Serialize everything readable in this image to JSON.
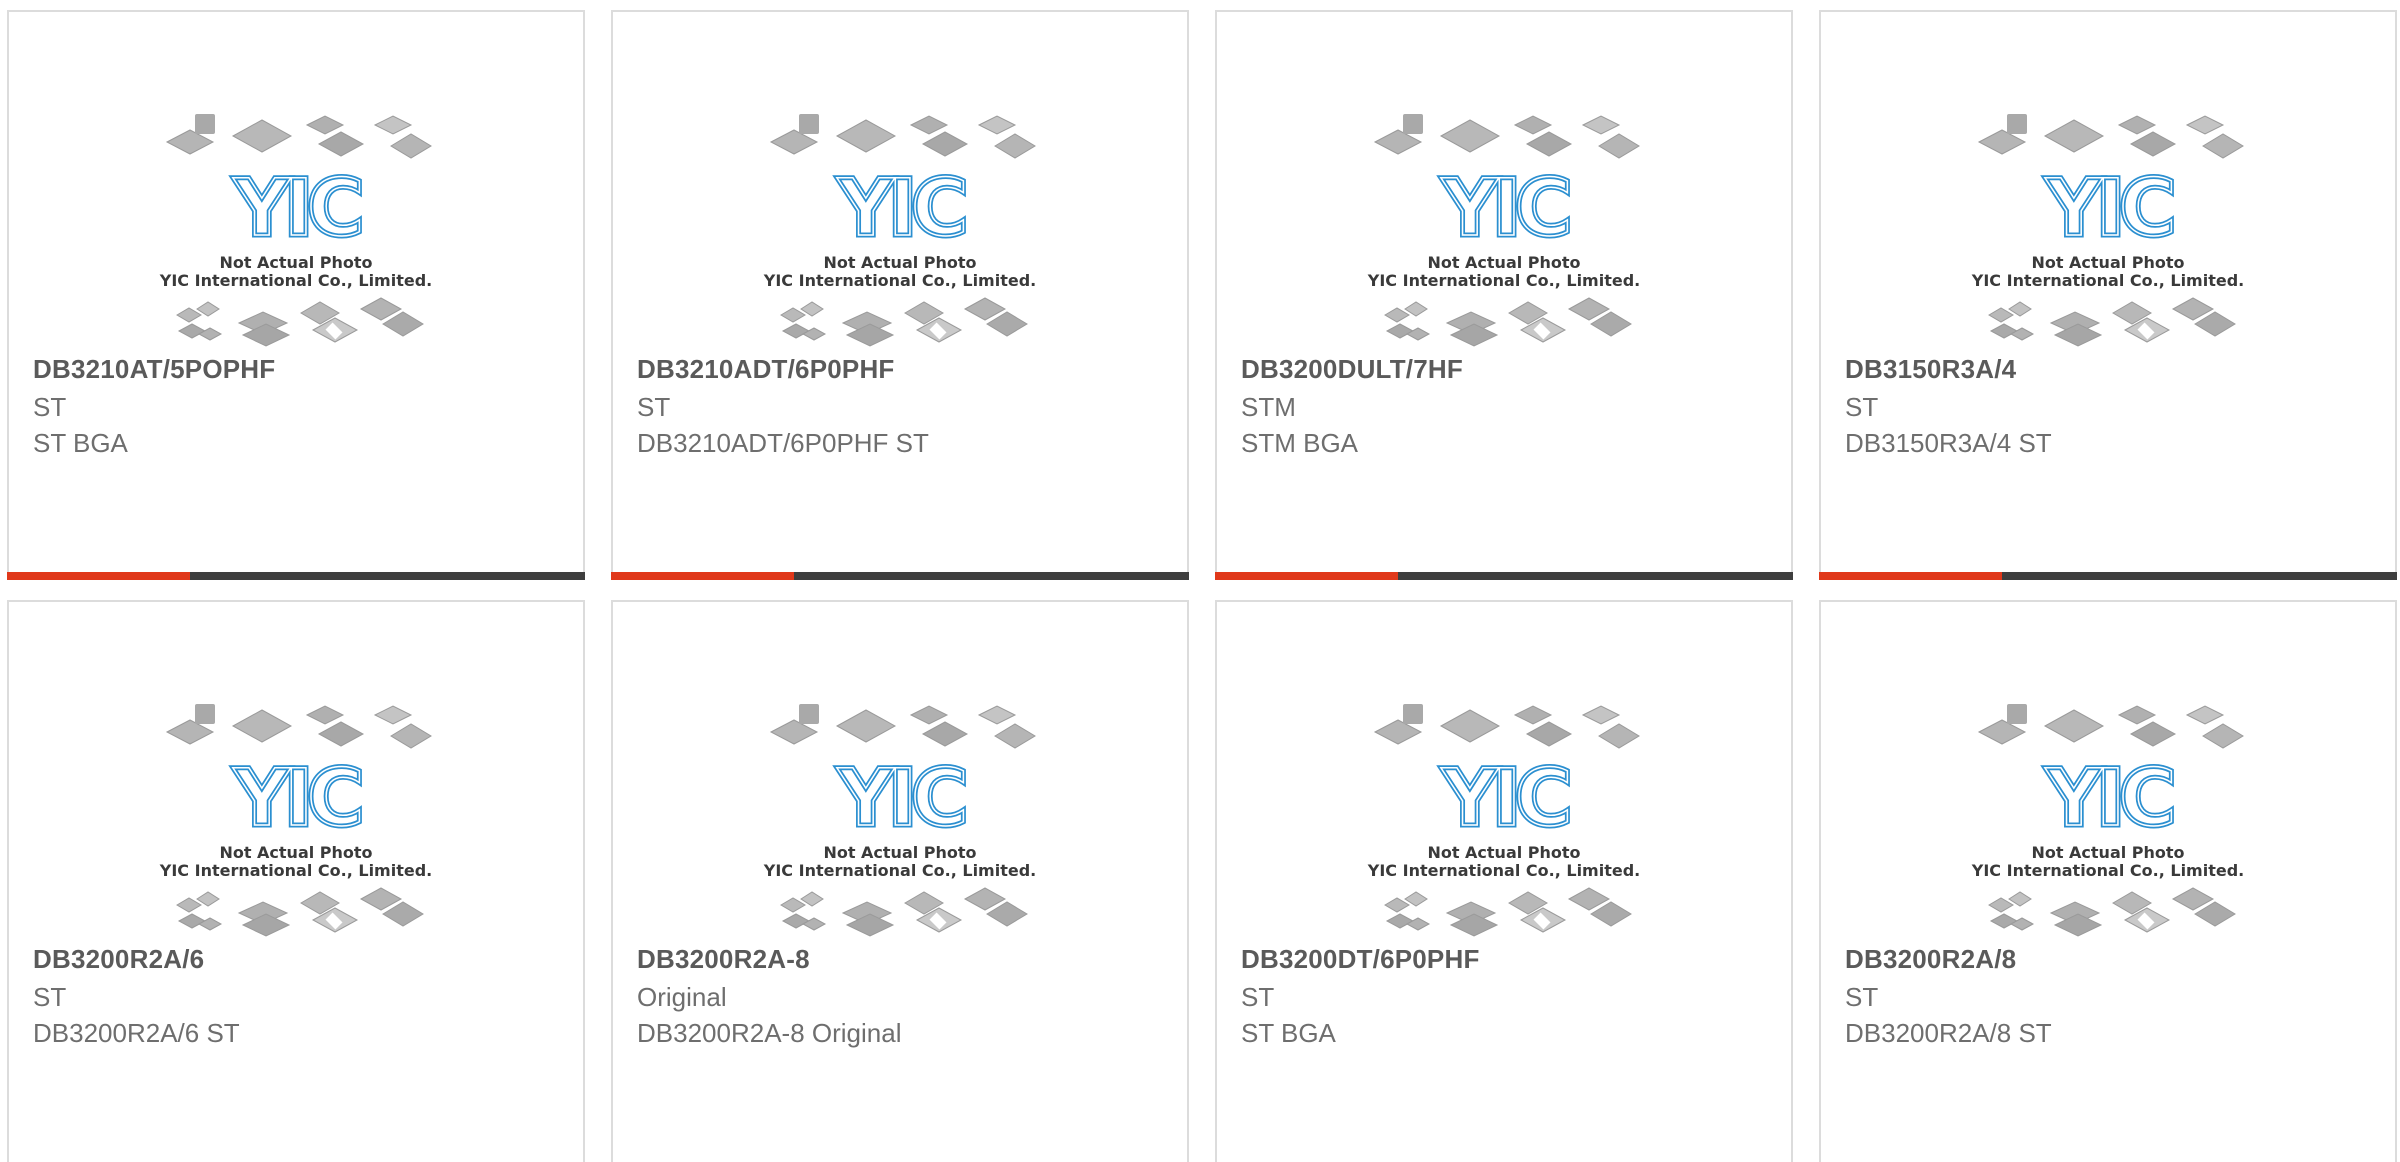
{
  "placeholder_image": {
    "line1": "Not Actual Photo",
    "line2": "YIC International Co., Limited.",
    "logo_text": "YIC"
  },
  "colors": {
    "accent": "#e0381a",
    "bar": "#3e3e3e",
    "logo_blue": "#2b8fd0"
  },
  "products": [
    {
      "part_number": "DB3210AT/5POPHF",
      "manufacturer": "ST",
      "description": "ST BGA"
    },
    {
      "part_number": "DB3210ADT/6P0PHF",
      "manufacturer": "ST",
      "description": "DB3210ADT/6P0PHF ST"
    },
    {
      "part_number": "DB3200DULT/7HF",
      "manufacturer": "STM",
      "description": "STM BGA"
    },
    {
      "part_number": "DB3150R3A/4",
      "manufacturer": "ST",
      "description": "DB3150R3A/4 ST"
    },
    {
      "part_number": "DB3200R2A/6",
      "manufacturer": "ST",
      "description": "DB3200R2A/6 ST"
    },
    {
      "part_number": "DB3200R2A-8",
      "manufacturer": "Original",
      "description": "DB3200R2A-8 Original"
    },
    {
      "part_number": "DB3200DT/6P0PHF",
      "manufacturer": "ST",
      "description": "ST BGA"
    },
    {
      "part_number": "DB3200R2A/8",
      "manufacturer": "ST",
      "description": "DB3200R2A/8 ST"
    }
  ]
}
